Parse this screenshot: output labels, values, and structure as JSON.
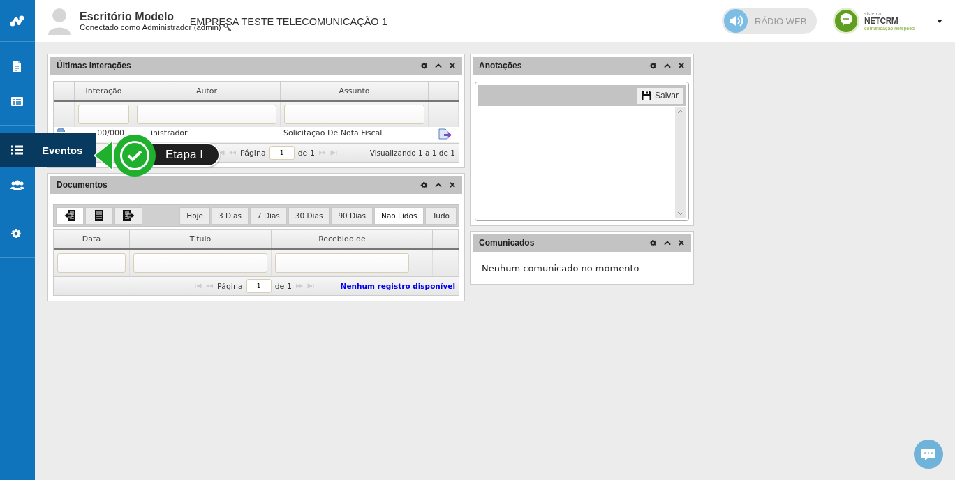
{
  "sidebar": {
    "items": [
      {
        "selected": false
      },
      {
        "selected": false
      },
      {
        "label": "Eventos",
        "selected": true
      },
      {
        "selected": false
      },
      {
        "selected": false
      }
    ]
  },
  "tour_step": {
    "label": "Etapa I"
  },
  "header": {
    "company": "Escritório Modelo",
    "user_line": "Conectado como Administrador (admin)",
    "tenant": "EMPRESA TESTE TELECOMUNICAÇÃO 1",
    "radio_button": "RÁDIO WEB",
    "radio_on": false,
    "brand": {
      "tagline_top": "sistema",
      "name": "NETCRM",
      "tagline_bottom": "comunicação netspeed"
    }
  },
  "interactions_panel": {
    "title": "Últimas Interações",
    "columns": [
      "Interação",
      "Autor",
      "Assunto"
    ],
    "rows": [
      {
        "cells": [
          "00/000",
          "inistrador",
          "Solicitação De Nota Fiscal"
        ]
      }
    ],
    "pager": {
      "page_label": "Página",
      "page": "1",
      "of": "de 1",
      "summary": "Visualizando 1 a 1 de 1",
      "kind": "summary"
    }
  },
  "documents_panel": {
    "title": "Documentos",
    "filters": [
      {
        "label": "Hoje",
        "selected": false
      },
      {
        "label": "3 Dias",
        "selected": false
      },
      {
        "label": "7 Dias",
        "selected": false
      },
      {
        "label": "30 Dias",
        "selected": false
      },
      {
        "label": "90 Dias",
        "selected": false
      },
      {
        "label": "Não Lidos",
        "selected": true
      },
      {
        "label": "Tudo",
        "selected": false
      }
    ],
    "columns": [
      "Data",
      "Titulo",
      "Recebido de"
    ],
    "pager": {
      "page_label": "Página",
      "page": "1",
      "of": "de 1",
      "summary": "Nenhum registro disponível",
      "kind": "empty"
    }
  },
  "notes_panel": {
    "title": "Anotações",
    "save_button": "Salvar"
  },
  "notices_panel": {
    "title": "Comunicados",
    "message": "Nenhum comunicado no momento"
  }
}
